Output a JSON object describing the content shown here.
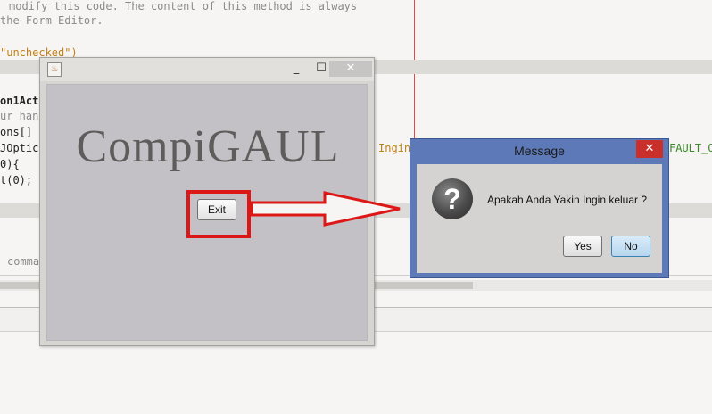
{
  "editor": {
    "lines": {
      "l1": "modify this code. The content of this method is always",
      "l2": "the Form Editor.",
      "l3": "\"unchecked\")",
      "l4": "on1Act",
      "l5": "ur han",
      "l6": "ons[]",
      "l7": "JOptic",
      "l8": "0){",
      "l9": "t(0);",
      "l10": "comma",
      "right1": "Ingin",
      "right2": "FAULT_O"
    }
  },
  "app": {
    "title": "CompiGAUL",
    "exit_label": "Exit",
    "min_glyph": "_",
    "max_glyph": "☐",
    "close_glyph": "✕"
  },
  "message": {
    "title": "Message",
    "text": "Apakah Anda Yakin Ingin keluar ?",
    "icon_glyph": "?",
    "yes_label": "Yes",
    "no_label": "No",
    "close_glyph": "✕"
  },
  "colors": {
    "highlight": "#dd1616",
    "dialog_frame": "#5d79b7",
    "dialog_close": "#c9302b"
  }
}
